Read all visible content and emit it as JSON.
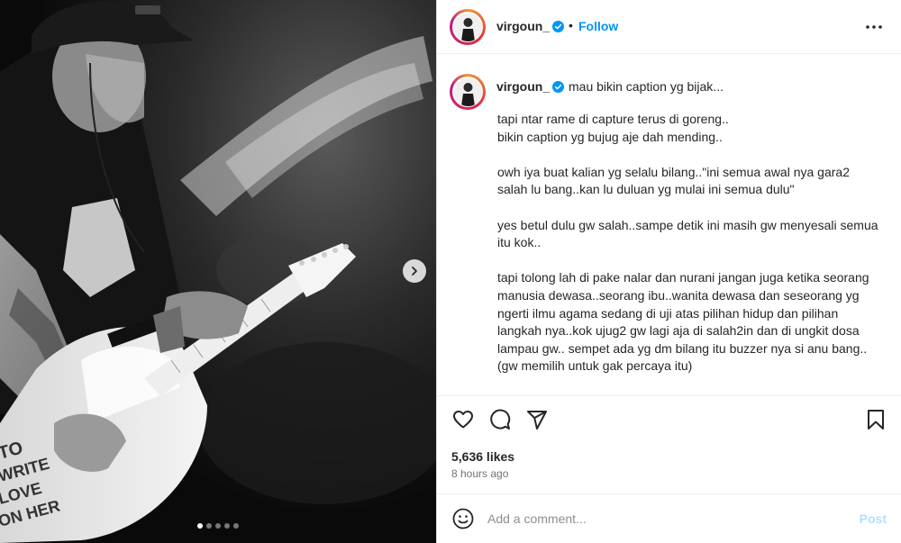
{
  "account": {
    "username": "virgoun_",
    "verified": true
  },
  "header": {
    "separator": "•",
    "follow_label": "Follow",
    "more_icon": "more-horizontal-icon"
  },
  "media": {
    "carousel_count": 5,
    "active_index": 0,
    "next_icon": "chevron-right-icon"
  },
  "caption": {
    "first_line": "mau bikin caption yg bijak...",
    "text": "tapi ntar rame di capture terus di goreng..\nbikin caption yg bujug aje dah mending..\n\nowh iya buat kalian yg selalu bilang..\"ini semua awal nya gara2\nsalah lu bang..kan lu duluan yg mulai ini semua dulu\"\n\nyes betul dulu gw salah..sampe detik ini masih gw menyesali semua\nitu kok..\n\ntapi tolong lah di pake nalar dan nurani jangan juga ketika seorang\nmanusia dewasa..seorang ibu..wanita dewasa dan seseorang yg\nngerti ilmu agama sedang di uji atas pilihan hidup dan pilihan\nlangkah nya..kok ujug2 gw lagi aja di salah2in dan di ungkit dosa\nlampau gw.. sempet ada yg dm bilang itu buzzer nya si anu bang..\n(gw memilih untuk gak percaya itu)\n\npertanyaan nya..klo after masalah ini dia khilaf lagi..or ada masalah"
  },
  "actions": {
    "like_icon": "heart-icon",
    "comment_icon": "comment-icon",
    "share_icon": "share-icon",
    "save_icon": "bookmark-icon"
  },
  "stats": {
    "likes": "5,636 likes",
    "time_ago": "8 hours ago"
  },
  "comment": {
    "emoji_icon": "emoji-icon",
    "placeholder": "Add a comment...",
    "post_label": "Post"
  },
  "colors": {
    "accent": "#0095f6",
    "post_disabled": "#b2dffc",
    "verified": "#0095f6",
    "text": "#262626",
    "muted": "#737373"
  }
}
